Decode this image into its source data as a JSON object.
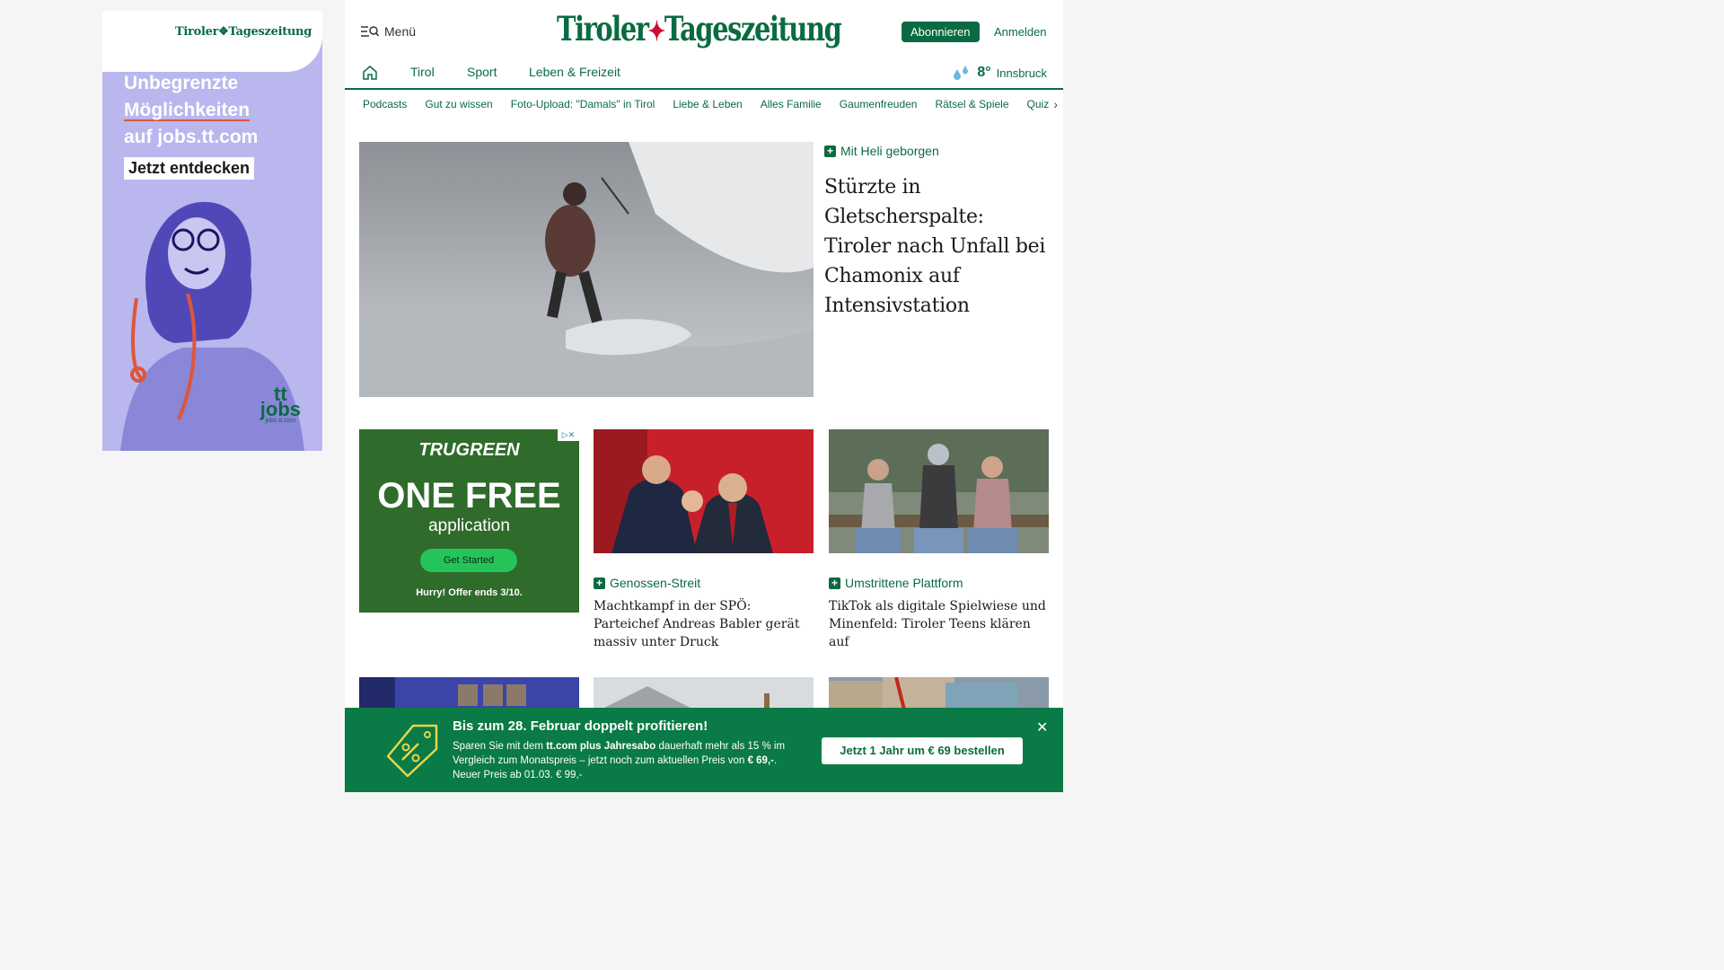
{
  "side_ad": {
    "logo": "Tiroler❖Tageszeitung",
    "line1": "Unbegrenzte",
    "line2": "Möglichkeiten",
    "line3": "auf jobs.tt.com",
    "cta": "Jetzt entdecken",
    "jobs_brand": "tt",
    "jobs_word": "jobs",
    "jobs_url": "jobs.tt.com"
  },
  "header": {
    "menu_label": "Menü",
    "logo_left": "Tiroler",
    "logo_right": "Tageszeitung",
    "subscribe_label": "Abonnieren",
    "login_label": "Anmelden"
  },
  "nav": {
    "items": [
      "Tirol",
      "Sport",
      "Leben & Freizeit"
    ]
  },
  "weather": {
    "temp": "8°",
    "city": "Innsbruck"
  },
  "subnav": {
    "items": [
      "Podcasts",
      "Gut zu wissen",
      "Foto-Upload: \"Damals\" in Tirol",
      "Liebe & Leben",
      "Alles Familie",
      "Gaumenfreuden",
      "Rätsel & Spiele",
      "Quiz"
    ]
  },
  "hero": {
    "kicker": "Mit Heli geborgen",
    "title": "Stürzte in Gletscherspalte: Tiroler nach Unfall bei Chamonix auf Intensivstation"
  },
  "ad_box": {
    "brand": "TRUGREEN",
    "headline": "ONE FREE",
    "sub": "application",
    "button": "Get Started",
    "note": "Hurry! Offer ends 3/10."
  },
  "cards": [
    {
      "kicker": "Genossen-Streit",
      "title": "Machtkampf in der SPÖ: Parteichef Andreas Babler gerät massiv unter Druck"
    },
    {
      "kicker": "Umstrittene Plattform",
      "title": "TikTok als digitale Spielwiese und Minenfeld: Tiroler Teens klären auf"
    }
  ],
  "promo": {
    "title": "Bis zum 28. Februar doppelt profitieren!",
    "text_1": "Sparen Sie mit dem ",
    "text_bold_1": "tt.com plus Jahresabo",
    "text_2": " dauerhaft mehr als 15 % im Vergleich zum Monatspreis – jetzt noch zum aktuellen Preis von ",
    "text_bold_2": "€ 69,-",
    "text_3": ". Neuer Preis ab 01.03. € 99,-",
    "button": "Jetzt 1 Jahr um € 69 bestellen",
    "close": "✕"
  }
}
